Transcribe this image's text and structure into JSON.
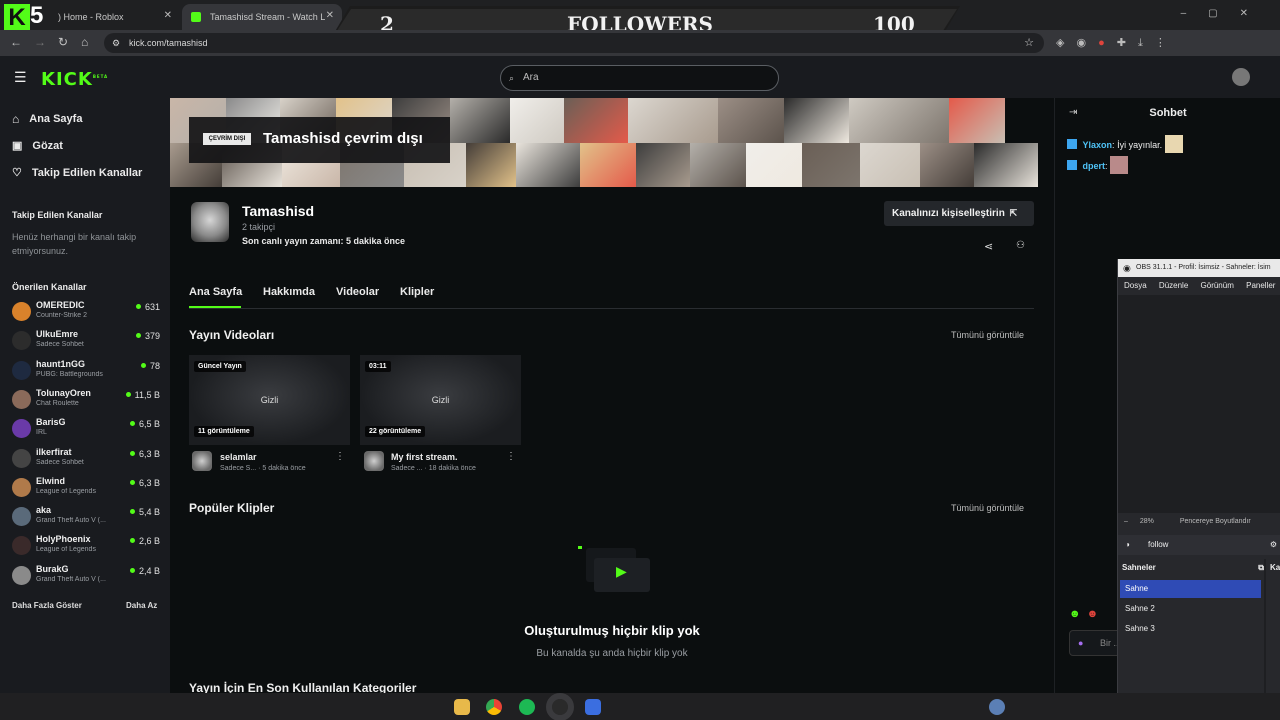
{
  "browser": {
    "tabs": [
      {
        "label": ") Home - Roblox",
        "active": false
      },
      {
        "label": "Tamashisd Stream - Watch Live",
        "active": true
      }
    ],
    "url": "kick.com/tamashisd"
  },
  "overlay": {
    "kick_letter": "K",
    "kick_number": "5",
    "followers_current": "2",
    "followers_label": "FOLLOWERS",
    "followers_goal": "100"
  },
  "header": {
    "logo": "KICK",
    "logo_badge": "BETA",
    "search_placeholder": "Ara"
  },
  "sidebar": {
    "nav": [
      {
        "label": "Ana Sayfa",
        "icon": "home-icon"
      },
      {
        "label": "Gözat",
        "icon": "browse-icon"
      },
      {
        "label": "Takip Edilen Kanallar",
        "icon": "heart-icon"
      }
    ],
    "followed_title": "Takip Edilen Kanallar",
    "followed_empty": "Henüz herhangi bir kanalı takip etmiyorsunuz.",
    "recommended_title": "Önerilen Kanallar",
    "recommended": [
      {
        "name": "OMEREDIC",
        "category": "Counter-Strike 2",
        "viewers": "631",
        "color": "#d9822b"
      },
      {
        "name": "UlkuEmre",
        "category": "Sadece Sohbet",
        "viewers": "379",
        "color": "#2c2c2c"
      },
      {
        "name": "haunt1nGG",
        "category": "PUBG: Battlegrounds",
        "viewers": "78",
        "color": "#1e2a40"
      },
      {
        "name": "TolunayOren",
        "category": "Chat Roulette",
        "viewers": "11,5 B",
        "color": "#8a6a5a"
      },
      {
        "name": "BarisG",
        "category": "IRL",
        "viewers": "6,5 B",
        "color": "#6a3aa8"
      },
      {
        "name": "ilkerfirat",
        "category": "Sadece Sohbet",
        "viewers": "6,3 B",
        "color": "#444"
      },
      {
        "name": "Elwind",
        "category": "League of Legends",
        "viewers": "6,3 B",
        "color": "#b07a4a"
      },
      {
        "name": "aka",
        "category": "Grand Theft Auto V (...",
        "viewers": "5,4 B",
        "color": "#5a6a7a"
      },
      {
        "name": "HolyPhoenix",
        "category": "League of Legends",
        "viewers": "2,6 B",
        "color": "#3a2a2a"
      },
      {
        "name": "BurakG",
        "category": "Grand Theft Auto V (...",
        "viewers": "2,4 B",
        "color": "#8a8a8a"
      }
    ],
    "show_more": "Daha Fazla Göster",
    "show_less": "Daha Az"
  },
  "channel": {
    "offline_badge": "ÇEVRİM DIŞI",
    "offline_title": "Tamashisd çevrim dışı",
    "name": "Tamashisd",
    "followers": "2 takipçi",
    "last_live": "Son canlı yayın zamanı: 5 dakika önce",
    "customize_button": "Kanalınızı kişiselleştirin",
    "tabs": [
      "Ana Sayfa",
      "Hakkımda",
      "Videolar",
      "Klipler"
    ],
    "videos_title": "Yayın Videoları",
    "view_all": "Tümünü görüntüle",
    "videos": [
      {
        "badge": "Güncel Yayın",
        "hidden": "Gizli",
        "views": "11 görüntüleme",
        "title": "selamlar",
        "meta": "Sadece S... · 5 dakika önce"
      },
      {
        "badge": "03:11",
        "hidden": "Gizli",
        "views": "22 görüntüleme",
        "title": "My first stream.",
        "meta": "Sadece ... · 18 dakika önce"
      }
    ],
    "clips_title": "Popüler Klipler",
    "clips_view_all": "Tümünü görüntüle",
    "no_clips_title": "Oluşturulmuş hiçbir klip yok",
    "no_clips_sub": "Bu kanalda şu anda hiçbir klip yok",
    "categories_title": "Yayın İçin En Son Kullanılan Kategoriler"
  },
  "chat": {
    "title": "Sohbet",
    "messages": [
      {
        "user": "Ylaxon",
        "text": "İyi yayınlar.",
        "color": "#4fc3f7"
      },
      {
        "user": "dpert",
        "text": "",
        "color": "#4fc3f7"
      }
    ],
    "input_placeholder": "Bir ..."
  },
  "obs": {
    "title": "OBS 31.1.1 - Profil: İsimsiz - Sahneler: İsim",
    "menu": [
      "Dosya",
      "Düzenle",
      "Görünüm",
      "Paneller"
    ],
    "zoom": "28%",
    "fit": "Pencereye Boyutlandır",
    "source": "follow",
    "scenes_title": "Sahneler",
    "scenes": [
      "Sahne",
      "Sahne 2",
      "Sahne 3"
    ],
    "sources_short": "Ka"
  }
}
